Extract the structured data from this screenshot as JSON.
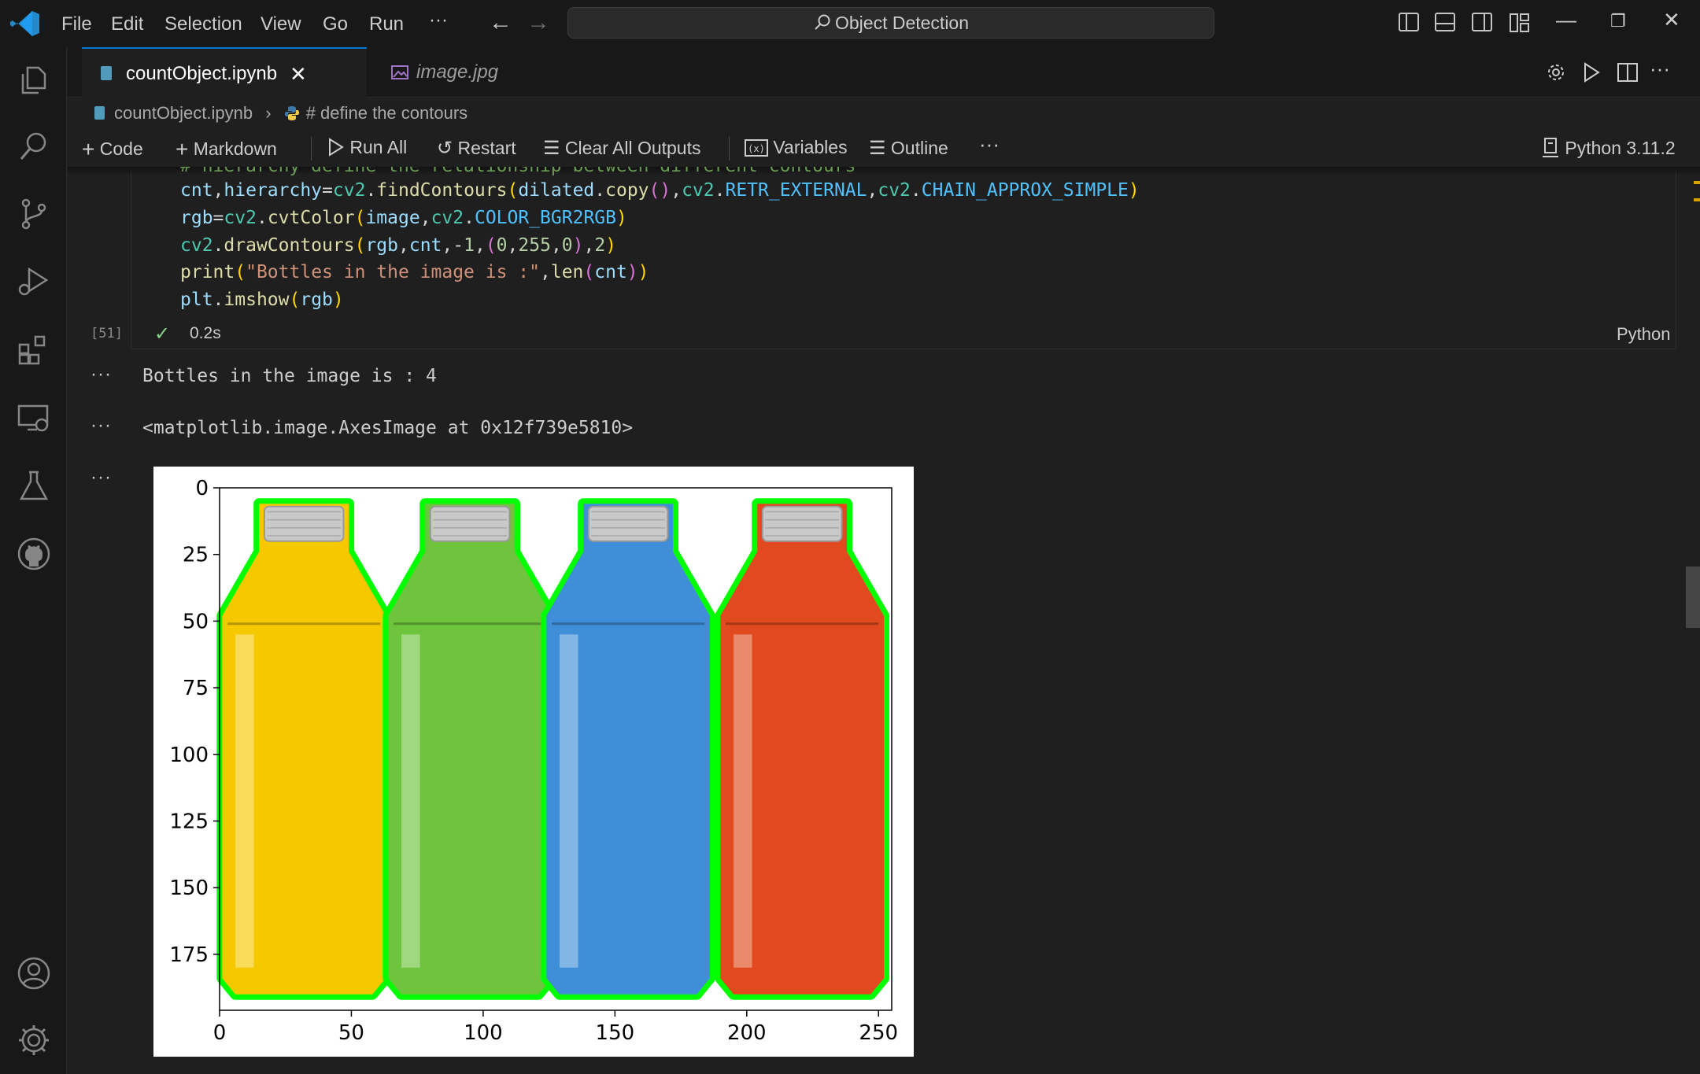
{
  "menu": [
    "File",
    "Edit",
    "Selection",
    "View",
    "Go",
    "Run"
  ],
  "menu_more": "···",
  "search": {
    "text": "Object Detection"
  },
  "tabs": [
    {
      "label": "countObject.ipynb",
      "active": true
    },
    {
      "label": "image.jpg",
      "active": false
    }
  ],
  "breadcrumb": {
    "file": "countObject.ipynb",
    "separator": "›",
    "symbol": "# define the contours"
  },
  "toolbar": {
    "code": "Code",
    "markdown": "Markdown",
    "run_all": "Run All",
    "restart": "Restart",
    "clear_outputs": "Clear All Outputs",
    "variables": "Variables",
    "outline": "Outline",
    "more": "···",
    "kernel": "Python 3.11.2"
  },
  "cell": {
    "partial_comment": "# hierarchy define the relationship between different contours",
    "execution_count": "[51]",
    "duration": "0.2s",
    "language": "Python"
  },
  "outputs": {
    "dots": "···",
    "print_line": "Bottles in the image is : 4",
    "repr_line": "<matplotlib.image.AxesImage at 0x12f739e5810>"
  },
  "chart_data": {
    "type": "image",
    "xticks": [
      0,
      50,
      100,
      150,
      200,
      250
    ],
    "yticks": [
      0,
      25,
      50,
      75,
      100,
      125,
      150,
      175
    ],
    "xlim": [
      0,
      255
    ],
    "ylim": [
      196,
      0
    ],
    "title": "",
    "xlabel": "",
    "ylabel": "",
    "bottles": [
      {
        "color": "#f5c800"
      },
      {
        "color": "#6ec43c"
      },
      {
        "color": "#3f8fd8"
      },
      {
        "color": "#e04a1e"
      }
    ],
    "contour_color": "#00ff00"
  },
  "colors": {
    "accent": "#0078d4",
    "background": "#1f1f1f",
    "success": "#89d185"
  }
}
